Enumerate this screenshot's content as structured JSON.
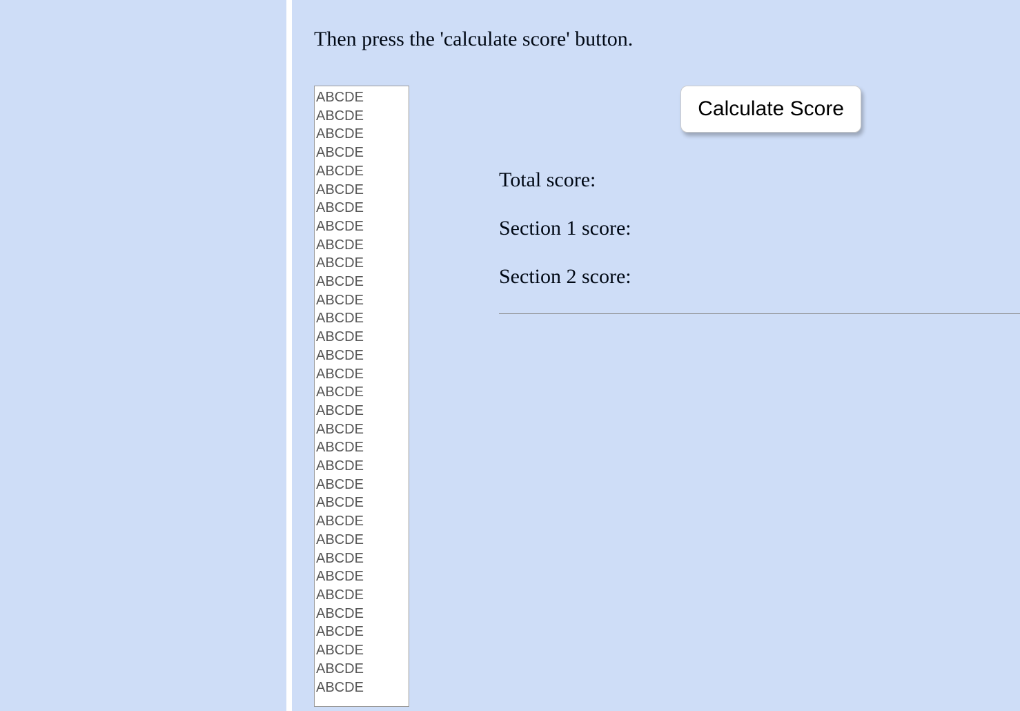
{
  "instruction": "Then press the 'calculate score' button.",
  "textarea_value": "ABCDE\nABCDE\nABCDE\nABCDE\nABCDE\nABCDE\nABCDE\nABCDE\nABCDE\nABCDE\nABCDE\nABCDE\nABCDE\nABCDE\nABCDE\nABCDE\nABCDE\nABCDE\nABCDE\nABCDE\nABCDE\nABCDE\nABCDE\nABCDE\nABCDE\nABCDE\nABCDE\nABCDE\nABCDE\nABCDE\nABCDE\nABCDE\nABCDE",
  "button_label": "Calculate Score",
  "scores": {
    "total_label": "Total score:",
    "section1_label": "Section 1 score:",
    "section2_label": "Section 2 score:"
  }
}
